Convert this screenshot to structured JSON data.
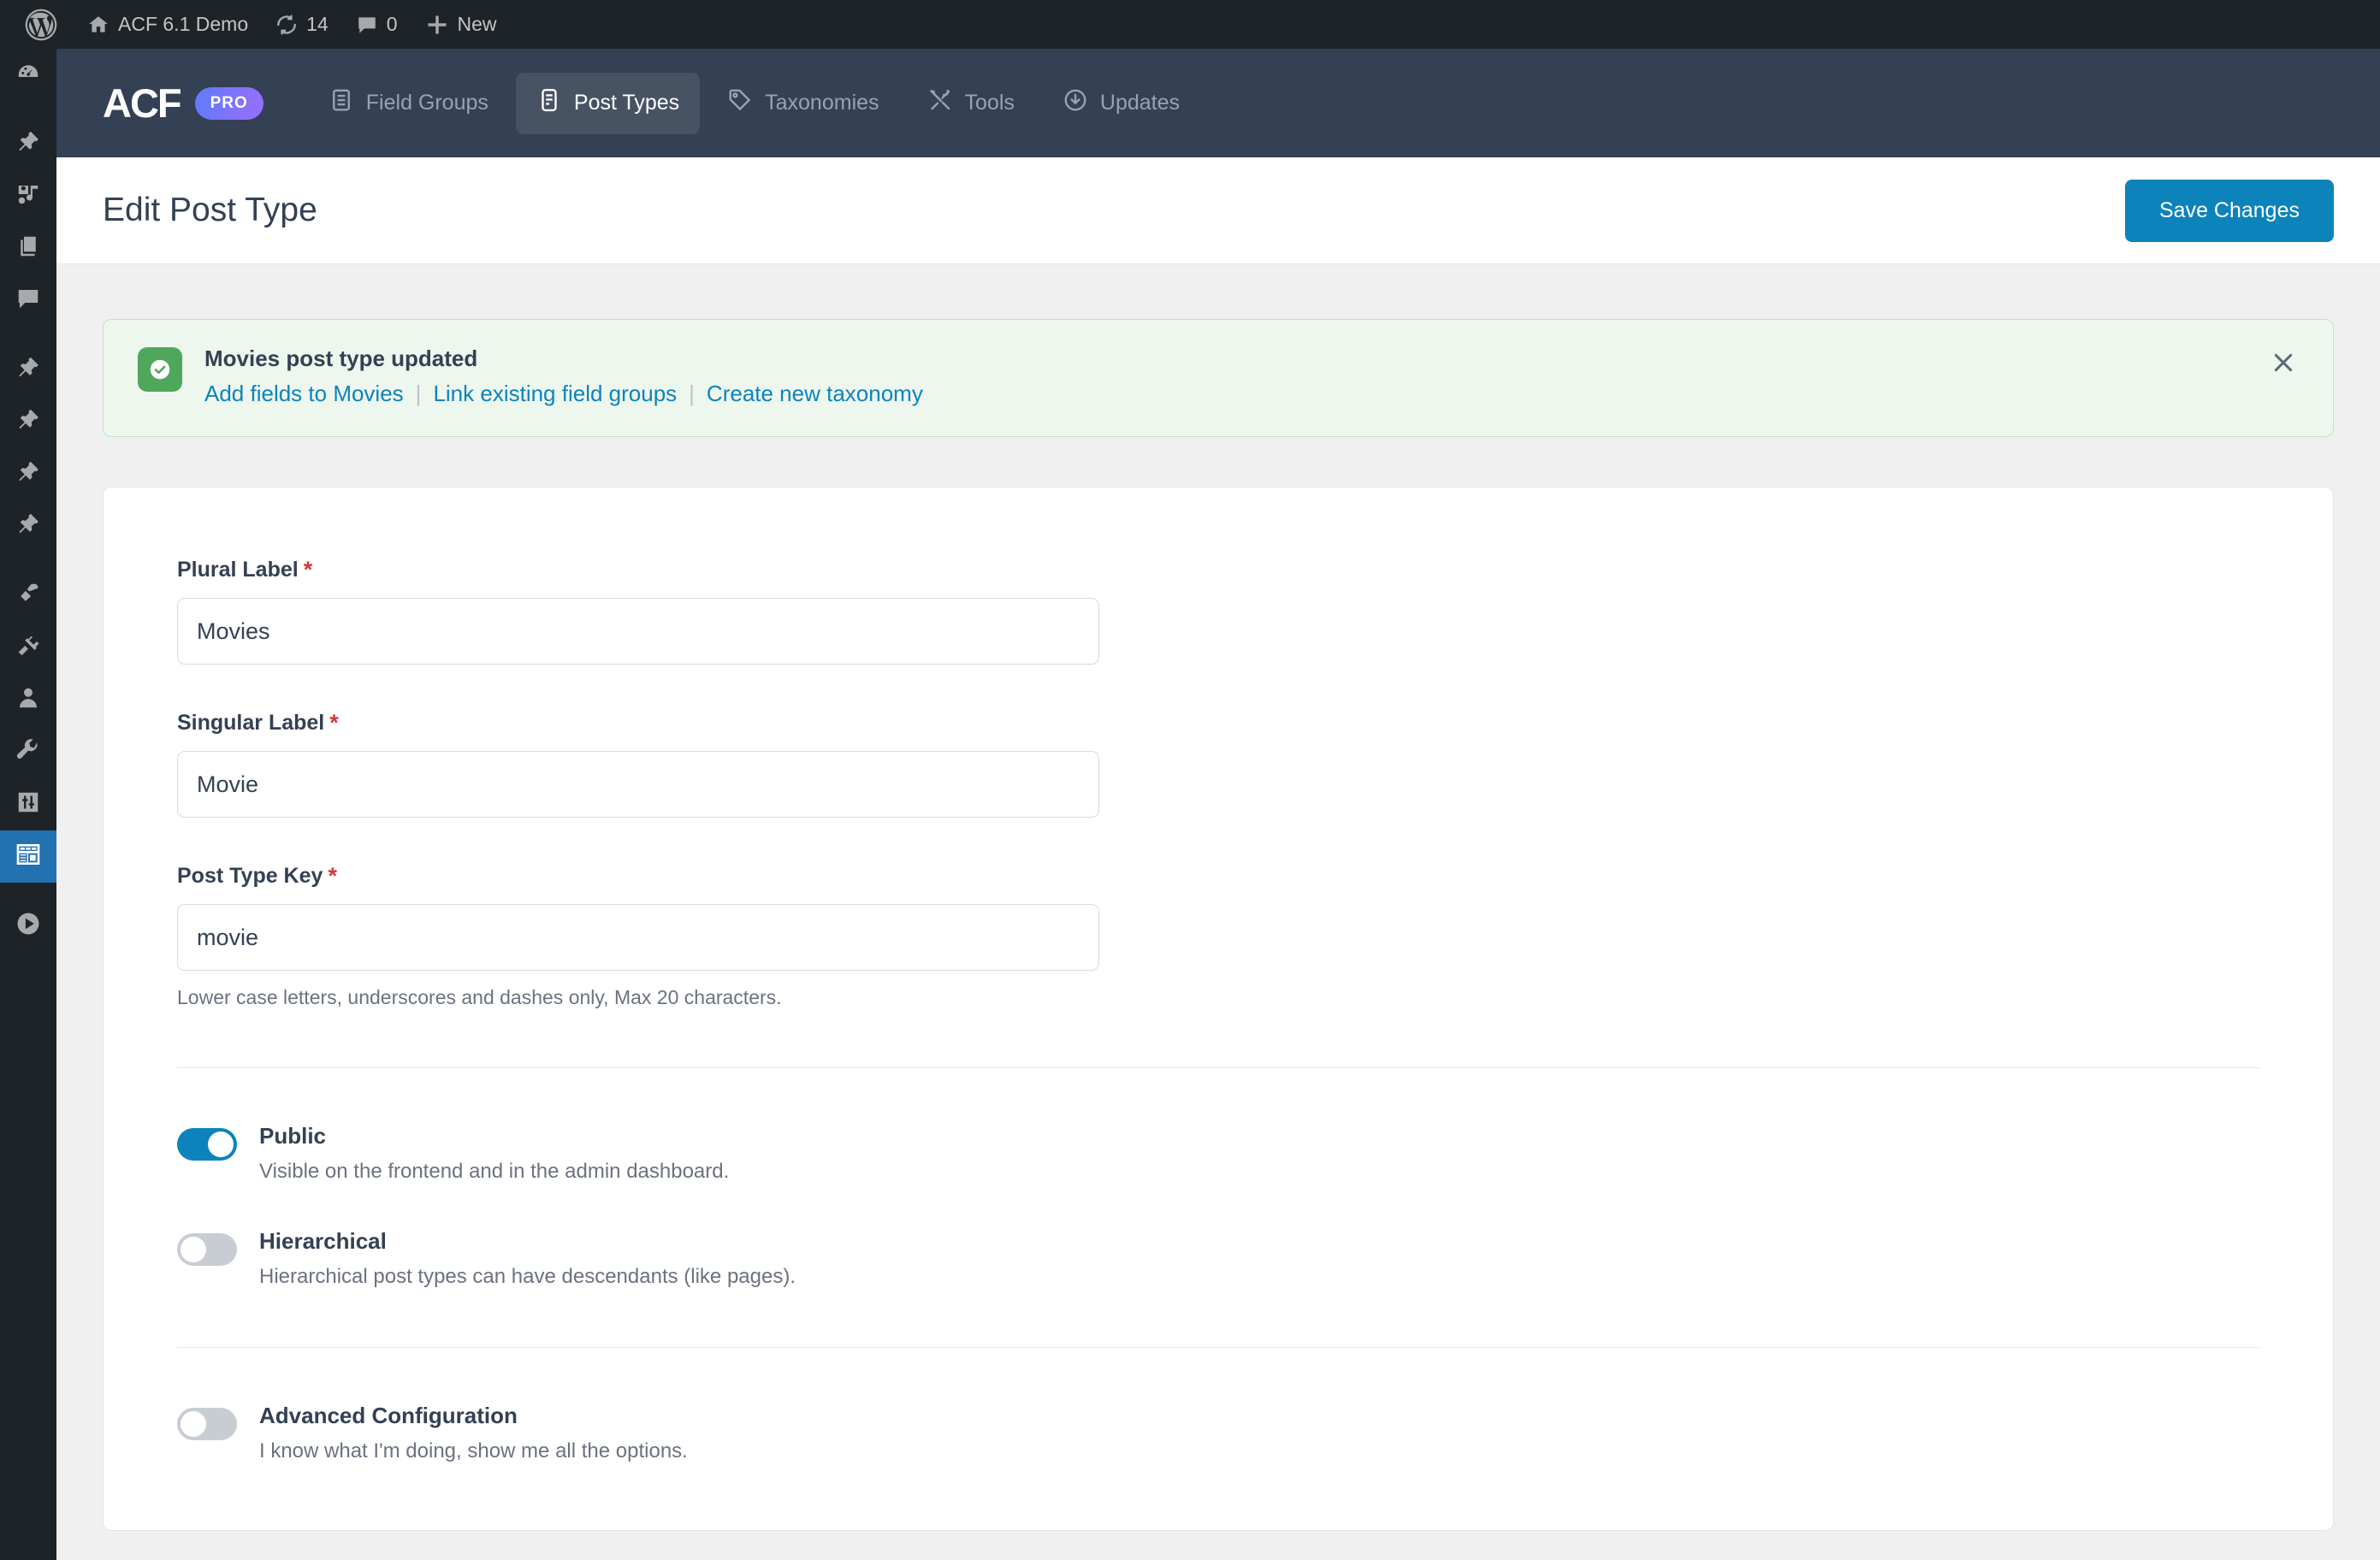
{
  "adminbar": {
    "site_name": "ACF 6.1 Demo",
    "updates_count": "14",
    "comments_count": "0",
    "new_label": "New"
  },
  "sidebar": {
    "items": [
      {
        "name": "dashboard",
        "icon": "gauge-icon",
        "active": false
      },
      {
        "name": "posts",
        "icon": "pin-icon",
        "active": false
      },
      {
        "name": "media",
        "icon": "media-icon",
        "active": false
      },
      {
        "name": "pages",
        "icon": "pages-icon",
        "active": false
      },
      {
        "name": "comments",
        "icon": "comment-icon",
        "active": false
      },
      {
        "name": "custom-1",
        "icon": "pin-icon",
        "active": false
      },
      {
        "name": "custom-2",
        "icon": "pin-icon",
        "active": false
      },
      {
        "name": "custom-3",
        "icon": "pin-icon",
        "active": false
      },
      {
        "name": "custom-4",
        "icon": "pin-icon",
        "active": false
      },
      {
        "name": "appearance",
        "icon": "brush-icon",
        "active": false
      },
      {
        "name": "plugins",
        "icon": "plug-icon",
        "active": false
      },
      {
        "name": "users",
        "icon": "user-icon",
        "active": false
      },
      {
        "name": "tools",
        "icon": "wrench-icon",
        "active": false
      },
      {
        "name": "settings",
        "icon": "sliders-icon",
        "active": false
      },
      {
        "name": "acf",
        "icon": "layout-icon",
        "active": true
      },
      {
        "name": "collapse",
        "icon": "play-icon",
        "active": false
      }
    ]
  },
  "acfnav": {
    "logo_text": "ACF",
    "pro_badge": "PRO",
    "tabs": [
      {
        "label": "Field Groups",
        "icon": "list-document-icon",
        "active": false
      },
      {
        "label": "Post Types",
        "icon": "post-type-icon",
        "active": true
      },
      {
        "label": "Taxonomies",
        "icon": "tag-icon",
        "active": false
      },
      {
        "label": "Tools",
        "icon": "tools-icon",
        "active": false
      },
      {
        "label": "Updates",
        "icon": "download-circle-icon",
        "active": false
      }
    ]
  },
  "header": {
    "title": "Edit Post Type",
    "save_label": "Save Changes"
  },
  "notice": {
    "title": "Movies post type updated",
    "links": [
      "Add fields to Movies",
      "Link existing field groups",
      "Create new taxonomy"
    ],
    "separator": "|",
    "close_label": "×"
  },
  "form": {
    "plural": {
      "label": "Plural Label",
      "required": "*",
      "value": "Movies",
      "placeholder": ""
    },
    "singular": {
      "label": "Singular Label",
      "required": "*",
      "value": "Movie",
      "placeholder": ""
    },
    "key": {
      "label": "Post Type Key",
      "required": "*",
      "value": "movie",
      "placeholder": "",
      "help": "Lower case letters, underscores and dashes only, Max 20 characters."
    },
    "toggles": [
      {
        "title": "Public",
        "desc": "Visible on the frontend and in the admin dashboard.",
        "on": true
      },
      {
        "title": "Hierarchical",
        "desc": "Hierarchical post types can have descendants (like pages).",
        "on": false
      },
      {
        "title": "Advanced Configuration",
        "desc": "I know what I'm doing, show me all the options.",
        "on": false
      }
    ]
  },
  "colors": {
    "accent_blue": "#0d83bb",
    "wp_active": "#2271b1",
    "acf_bar": "#344054",
    "notice_green": "#4fa75c",
    "required_red": "#d63638"
  }
}
